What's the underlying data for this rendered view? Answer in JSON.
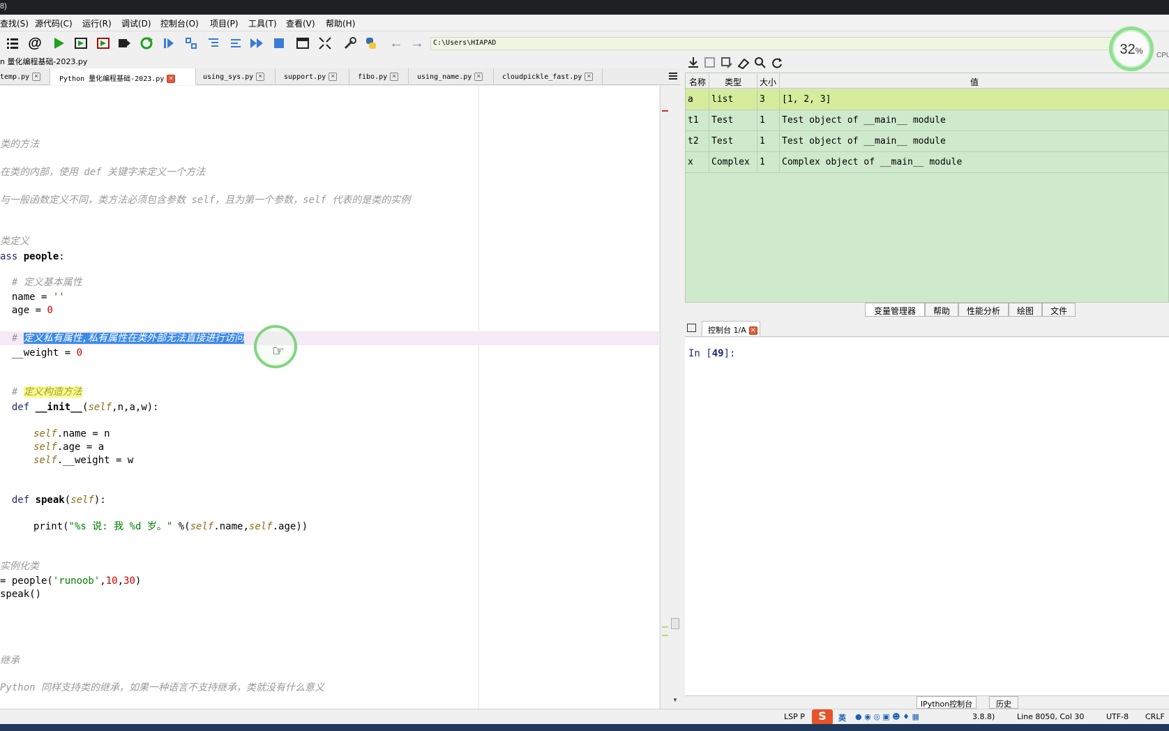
{
  "window": {
    "title_fragment": "8)"
  },
  "menu": [
    "查找(S)",
    "源代码(C)",
    "运行(R)",
    "调试(D)",
    "控制台(O)",
    "项目(P)",
    "工具(T)",
    "查看(V)",
    "帮助(H)"
  ],
  "toolbar": {
    "icons": [
      "outline-icon",
      "at-icon",
      "run-icon",
      "run-cell-icon",
      "run-cell-advance-icon",
      "run-selection-icon",
      "rerun-icon",
      "debug-icon",
      "step-icon",
      "step-into-icon",
      "step-return-icon",
      "continue-icon",
      "stop-icon",
      "maximize-pane-icon",
      "fullscreen-icon",
      "preferences-icon",
      "python-path-icon",
      "back-icon",
      "forward-icon"
    ],
    "working_dir": "C:\\Users\\HIAPAD"
  },
  "cpu": {
    "percent": "32",
    "unit": "%",
    "label": "CPU"
  },
  "editor": {
    "file_path": "n 量化编程基础-2023.py",
    "tabs": [
      {
        "label": "temp.py",
        "active": false
      },
      {
        "label": "Python 量化编程基础-2023.py",
        "active": true
      },
      {
        "label": "using_sys.py",
        "active": false
      },
      {
        "label": "support.py",
        "active": false
      },
      {
        "label": "fibo.py",
        "active": false
      },
      {
        "label": "using_name.py",
        "active": false
      },
      {
        "label": "cloudpickle_fast.py",
        "active": false
      }
    ],
    "lines": {
      "l1": "类的方法",
      "l2": "在类的内部，使用 def 关键字来定义一个方法",
      "l3": "与一般函数定义不同，类方法必须包含参数 self，且为第一个参数，self 代表的是类的实例",
      "l4": "类定义",
      "l5_kw": "ass ",
      "l5_name": "people",
      "l5_end": ":",
      "l6": "  # 定义基本属性",
      "l7_a": "  name = ",
      "l7_b": "''",
      "l8_a": "  age = ",
      "l8_b": "0",
      "l9_hash": "  # ",
      "l9_sel": "定义私有属性,私有属性在类外部无法直接进行访问",
      "l10_a": "  __weight = ",
      "l10_b": "0",
      "l11_hash": "  # ",
      "l11_hl": "定义构造方法",
      "l12_def": "  def ",
      "l12_name": "__init__",
      "l12_p": "(",
      "l12_self": "self",
      "l12_rest": ",n,a,w):",
      "l13_self": "self",
      "l13_rest": ".name = n",
      "l14_self": "self",
      "l14_rest": ".age = a",
      "l15_self": "self",
      "l15_rest": ".__weight = w",
      "l16_def": "  def ",
      "l16_name": "speak",
      "l16_p": "(",
      "l16_self": "self",
      "l16_rest": "):",
      "l17_a": "print(",
      "l17_str": "\"%s 说: 我 %d 岁。\"",
      "l17_b": " %(",
      "l17_self1": "self",
      "l17_c": ".name,",
      "l17_self2": "self",
      "l17_d": ".age))",
      "l18": "实例化类",
      "l19_a": "= people(",
      "l19_str": "'runoob'",
      "l19_b": ",",
      "l19_n1": "10",
      "l19_c": ",",
      "l19_n2": "30",
      "l19_d": ")",
      "l20": "speak()",
      "l21": "继承",
      "l22": "Python 同样支持类的继承，如果一种语言不支持继承，类就没有什么意义"
    }
  },
  "variables": {
    "headers": {
      "name": "名称",
      "type": "类型",
      "size": "大小",
      "value": "值"
    },
    "rows": [
      {
        "name": "a",
        "type": "list",
        "size": "3",
        "value": "[1, 2, 3]"
      },
      {
        "name": "t1",
        "type": "Test",
        "size": "1",
        "value": "Test object of __main__ module"
      },
      {
        "name": "t2",
        "type": "Test",
        "size": "1",
        "value": "Test object of __main__ module"
      },
      {
        "name": "x",
        "type": "Complex",
        "size": "1",
        "value": "Complex object of __main__ module"
      }
    ]
  },
  "pane_tabs": [
    "变量管理器",
    "帮助",
    "性能分析",
    "绘图",
    "文件"
  ],
  "console": {
    "tab": "控制台 1/A",
    "prompt_prefix": "In [",
    "prompt_num": "49",
    "prompt_suffix": "]:",
    "bottom_tabs": [
      "IPython控制台",
      "历史"
    ]
  },
  "status": {
    "lsp": "LSP P",
    "ime": "英",
    "python": "3.8.8)",
    "position": "Line 8050, Col 30",
    "encoding": "UTF-8",
    "eol": "CRLF"
  }
}
